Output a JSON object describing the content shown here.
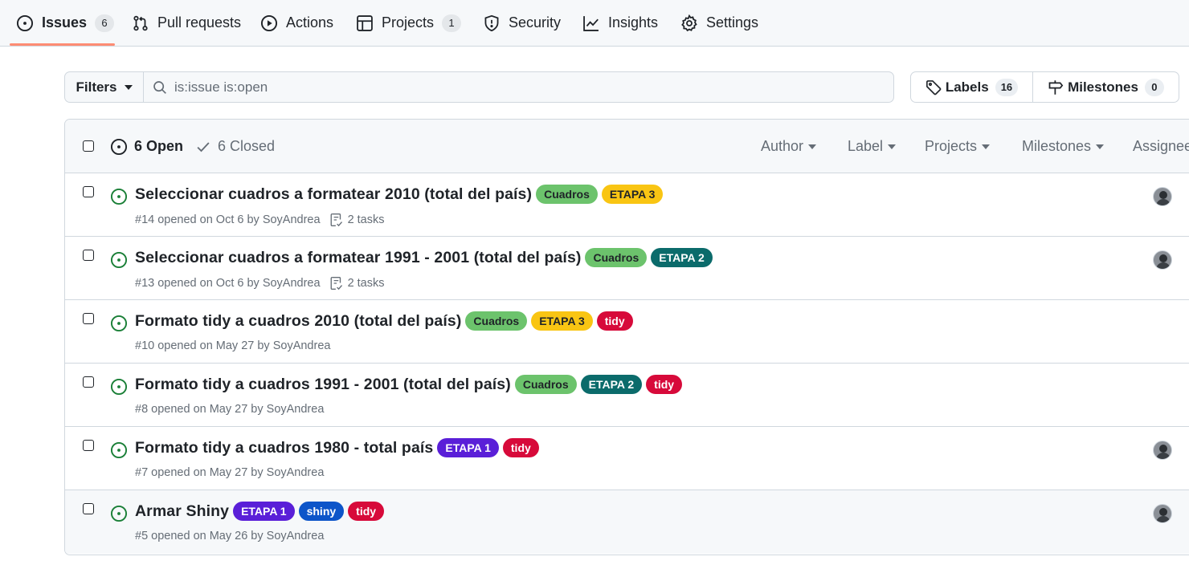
{
  "nav": {
    "tabs": [
      {
        "label": "Issues",
        "count": "6",
        "icon": "issue-opened-icon"
      },
      {
        "label": "Pull requests",
        "icon": "git-pull-request-icon"
      },
      {
        "label": "Actions",
        "icon": "play-icon"
      },
      {
        "label": "Projects",
        "count": "1",
        "icon": "table-icon"
      },
      {
        "label": "Security",
        "icon": "shield-icon"
      },
      {
        "label": "Insights",
        "icon": "graph-icon"
      },
      {
        "label": "Settings",
        "icon": "gear-icon"
      }
    ],
    "selected": "Issues",
    "accent": "#fd8c73"
  },
  "filters": {
    "button_label": "Filters",
    "search_value": "is:issue is:open"
  },
  "labels_button": {
    "label": "Labels",
    "count": "16"
  },
  "milestones_button": {
    "label": "Milestones",
    "count": "0"
  },
  "list_header": {
    "open_label": "6 Open",
    "closed_label": "6 Closed",
    "filters": [
      "Author",
      "Label",
      "Projects",
      "Milestones",
      "Assignee"
    ]
  },
  "issues": [
    {
      "title": "Seleccionar cuadros a formatear 2010 (total del país)",
      "labels": [
        {
          "name": "Cuadros",
          "bg": "#6cc36c",
          "fg": "#1f2328"
        },
        {
          "name": "ETAPA 3",
          "bg": "#f9c513",
          "fg": "#1f2328"
        }
      ],
      "meta": "#14 opened on Oct 6 by SoyAndrea",
      "tasks": "2 tasks",
      "has_avatar": true
    },
    {
      "title": "Seleccionar cuadros a formatear 1991 - 2001 (total del país)",
      "labels": [
        {
          "name": "Cuadros",
          "bg": "#6cc36c",
          "fg": "#1f2328"
        },
        {
          "name": "ETAPA 2",
          "bg": "#0b6b6b",
          "fg": "#ffffff"
        }
      ],
      "meta": "#13 opened on Oct 6 by SoyAndrea",
      "tasks": "2 tasks",
      "has_avatar": true
    },
    {
      "title": "Formato tidy a cuadros 2010 (total del país)",
      "labels": [
        {
          "name": "Cuadros",
          "bg": "#6cc36c",
          "fg": "#1f2328"
        },
        {
          "name": "ETAPA 3",
          "bg": "#f9c513",
          "fg": "#1f2328"
        },
        {
          "name": "tidy",
          "bg": "#d70a3a",
          "fg": "#ffffff"
        }
      ],
      "meta": "#10 opened on May 27 by SoyAndrea",
      "tasks": "",
      "has_avatar": false
    },
    {
      "title": "Formato tidy a cuadros 1991 - 2001 (total del país)",
      "labels": [
        {
          "name": "Cuadros",
          "bg": "#6cc36c",
          "fg": "#1f2328"
        },
        {
          "name": "ETAPA 2",
          "bg": "#0b6b6b",
          "fg": "#ffffff"
        },
        {
          "name": "tidy",
          "bg": "#d70a3a",
          "fg": "#ffffff"
        }
      ],
      "meta": "#8 opened on May 27 by SoyAndrea",
      "tasks": "",
      "has_avatar": false
    },
    {
      "title": "Formato tidy a cuadros 1980 - total país",
      "labels": [
        {
          "name": "ETAPA 1",
          "bg": "#5a1fd8",
          "fg": "#ffffff"
        },
        {
          "name": "tidy",
          "bg": "#d70a3a",
          "fg": "#ffffff"
        }
      ],
      "meta": "#7 opened on May 27 by SoyAndrea",
      "tasks": "",
      "has_avatar": true
    },
    {
      "title": "Armar Shiny",
      "labels": [
        {
          "name": "ETAPA 1",
          "bg": "#5a1fd8",
          "fg": "#ffffff"
        },
        {
          "name": "shiny",
          "bg": "#0d55c9",
          "fg": "#ffffff"
        },
        {
          "name": "tidy",
          "bg": "#d70a3a",
          "fg": "#ffffff"
        }
      ],
      "meta": "#5 opened on May 26 by SoyAndrea",
      "tasks": "",
      "has_avatar": true
    }
  ],
  "colors": {
    "open_green": "#1a7f37",
    "muted": "#656d76",
    "border": "#d0d7de"
  }
}
